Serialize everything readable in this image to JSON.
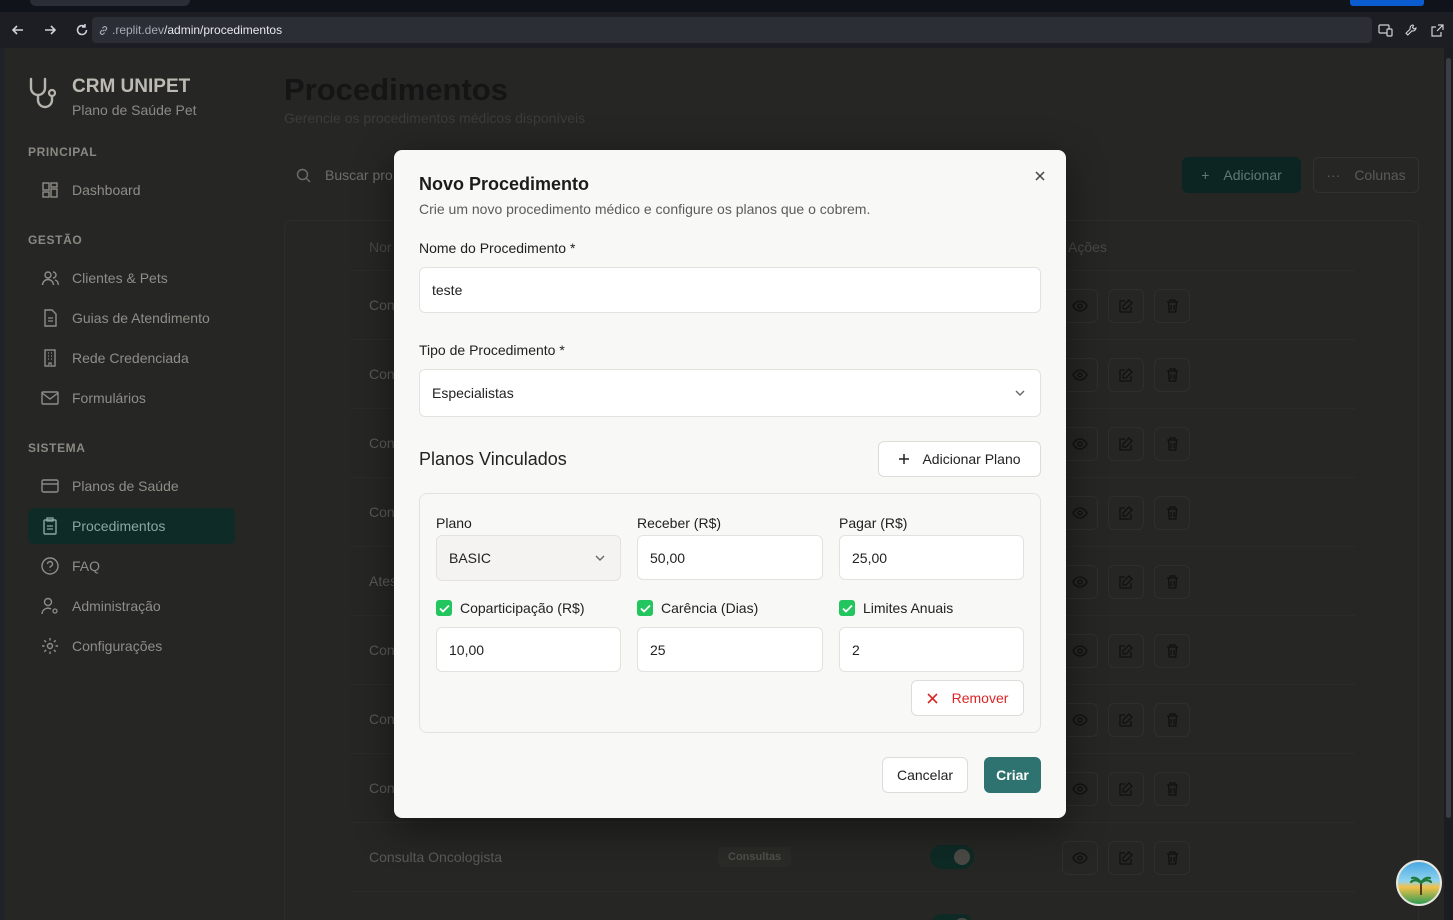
{
  "browser": {
    "url_prefix": ".replit.dev",
    "url_path": "/admin/procedimentos"
  },
  "brand": {
    "title": "CRM UNIPET",
    "subtitle": "Plano de Saúde Pet"
  },
  "sidebar": {
    "sections": [
      {
        "title": "PRINCIPAL"
      },
      {
        "title": "GESTÃO"
      },
      {
        "title": "SISTEMA"
      }
    ],
    "items": [
      {
        "label": "Dashboard",
        "icon": "dashboard-icon"
      },
      {
        "label": "Clientes & Pets",
        "icon": "users-icon"
      },
      {
        "label": "Guias de Atendimento",
        "icon": "document-icon"
      },
      {
        "label": "Rede Credenciada",
        "icon": "building-icon"
      },
      {
        "label": "Formulários",
        "icon": "mail-icon"
      },
      {
        "label": "Planos de Saúde",
        "icon": "card-icon"
      },
      {
        "label": "Procedimentos",
        "icon": "clipboard-icon",
        "active": true
      },
      {
        "label": "FAQ",
        "icon": "help-icon"
      },
      {
        "label": "Administração",
        "icon": "user-cog-icon"
      },
      {
        "label": "Configurações",
        "icon": "gear-icon"
      }
    ]
  },
  "page": {
    "title": "Procedimentos",
    "subtitle": "Gerencie os procedimentos médicos disponíveis",
    "search_placeholder": "Buscar pro",
    "add_label": "Adicionar",
    "columns_label": "Colunas",
    "table": {
      "col_name": "Nor",
      "col_actions": "Ações",
      "rows": [
        {
          "name": "Con"
        },
        {
          "name": "Con"
        },
        {
          "name": "Con"
        },
        {
          "name": "Con"
        },
        {
          "name": "Ates"
        },
        {
          "name": "Con"
        },
        {
          "name": "Con"
        },
        {
          "name": "Con"
        },
        {
          "name": "Consulta Oncologista",
          "type": "Consultas",
          "active": true
        }
      ]
    }
  },
  "modal": {
    "title": "Novo Procedimento",
    "subtitle": "Crie um novo procedimento médico e configure os planos que o cobrem.",
    "name_label": "Nome do Procedimento *",
    "name_value": "teste",
    "type_label": "Tipo de Procedimento *",
    "type_value": "Especialistas",
    "plans_title": "Planos Vinculados",
    "add_plan_label": "Adicionar Plano",
    "plan": {
      "plan_label": "Plano",
      "plan_value": "BASIC",
      "receive_label": "Receber (R$)",
      "receive_value": "50,00",
      "pay_label": "Pagar (R$)",
      "pay_value": "25,00",
      "copay_label": "Coparticipação (R$)",
      "copay_value": "10,00",
      "grace_label": "Carência (Dias)",
      "grace_value": "25",
      "limits_label": "Limites Anuais",
      "limits_value": "2",
      "remove_label": "Remover"
    },
    "cancel_label": "Cancelar",
    "create_label": "Criar"
  },
  "colors": {
    "primary": "#2f7371",
    "success": "#22c55e",
    "danger": "#dc2626"
  }
}
